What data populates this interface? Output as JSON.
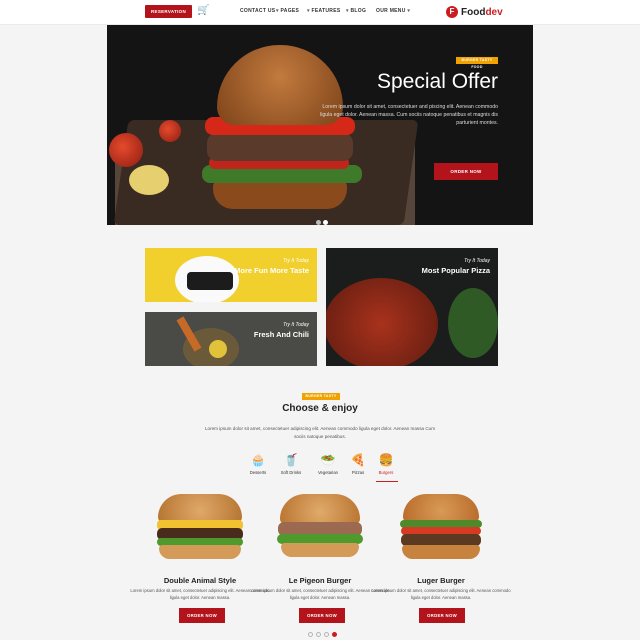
{
  "nav": {
    "logo_prefix": "Food",
    "logo_suffix": "dev",
    "links": [
      "OUR MENU",
      "BLOG",
      "FEATURES",
      "PAGES",
      "CONTACT US"
    ],
    "reservation_label": "RESERVATION"
  },
  "hero": {
    "tag": "BURGER TASTY FOOD",
    "title": "Special Offer",
    "text": "Lorem ipsum dolor sit amet, consectetuer and piscing elit. Aenean commodo ligula eget dolor. Aenean massa. Cum sociis natoque penatibus et magnis dis parturient montes.",
    "button_label": "ORDER NOW"
  },
  "promos": [
    {
      "kicker": "Try It Today",
      "title": "More Fun More Taste"
    },
    {
      "kicker": "Try It Today",
      "title": "Fresh And Chili"
    },
    {
      "kicker": "Try It Today",
      "title": "Most Popular Pizza"
    }
  ],
  "section": {
    "tag": "BURGER TASTY FOOD",
    "title": "Choose & enjoy",
    "text": "Lorem ipsum dolor sit amet, consectetuer adipiscing elit. Aenean commodo ligula eget dolor. Aenean massa Cum sociis natoque penatibus."
  },
  "categories": [
    {
      "label": "Burgers",
      "icon": "burger-icon"
    },
    {
      "label": "Pizzas",
      "icon": "pizza-icon"
    },
    {
      "label": "Vegetarian",
      "icon": "salad-icon"
    },
    {
      "label": "Soft Drinks",
      "icon": "drink-icon"
    },
    {
      "label": "Desserts",
      "icon": "cupcake-icon"
    }
  ],
  "products": [
    {
      "name": "Luger Burger",
      "desc": "Lorem ipsum dolor sit amet, consectetuer adipiscing elit. Aenean commodo ligula eget dolor. Aenean massa.",
      "button": "ORDER NOW"
    },
    {
      "name": "Le Pigeon Burger",
      "desc": "Lorem ipsum dolor sit amet, consectetuer adipiscing elit. Aenean commodo ligula eget dolor. Aenean massa.",
      "button": "ORDER NOW"
    },
    {
      "name": "Double Animal Style",
      "desc": "Lorem ipsum dolor sit amet, consectetuer adipiscing elit. Aenean commodo ligula eget dolor. Aenean massa.",
      "button": "ORDER NOW"
    }
  ],
  "colors": {
    "brand_red": "#b3141b",
    "accent_orange": "#f0a300",
    "promo_yellow": "#f1cf2c"
  }
}
